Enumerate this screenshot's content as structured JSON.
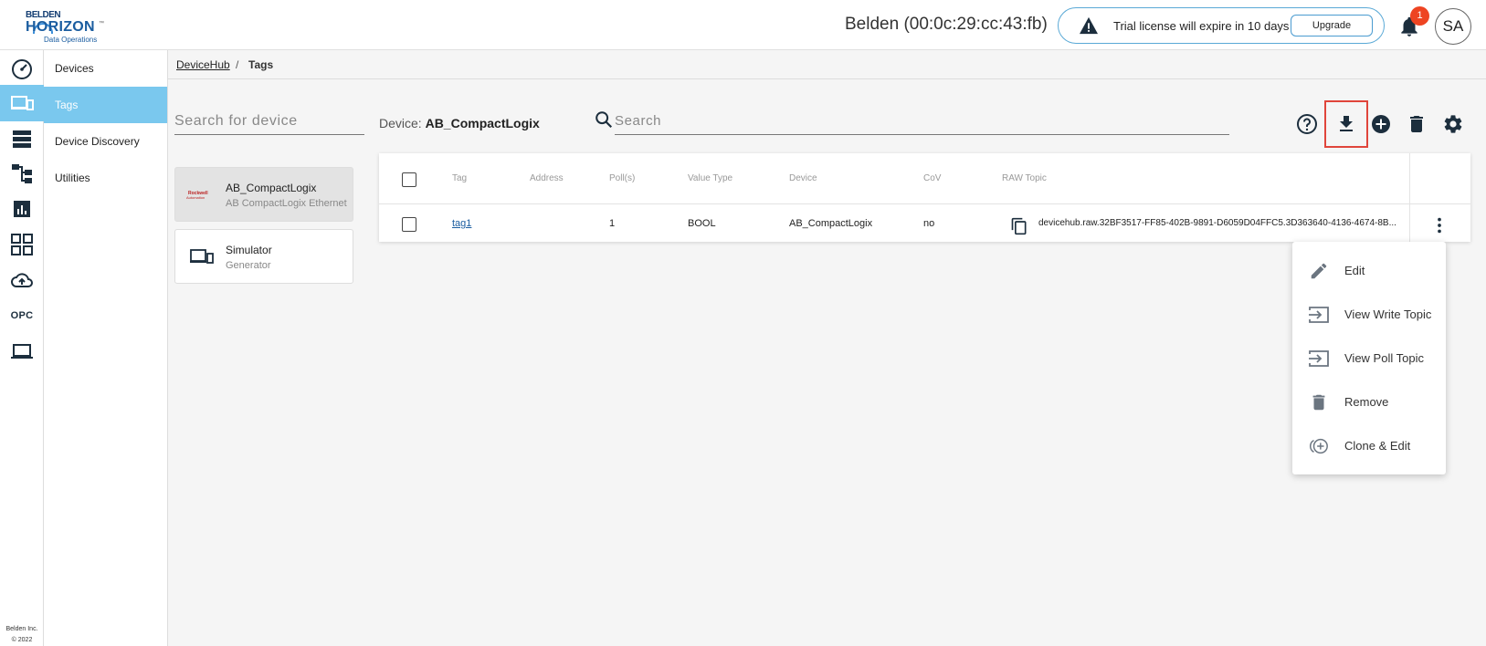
{
  "header": {
    "logo_brand": "BELDEN",
    "logo_product": "HORIZON",
    "logo_tm": "™",
    "logo_sub": "Data Operations",
    "device_id": "Belden (00:0c:29:cc:43:fb)",
    "trial_text": "Trial license will expire in 10 days",
    "upgrade_label": "Upgrade",
    "notification_count": "1",
    "avatar_initials": "SA"
  },
  "rail": {
    "icons": [
      "dashboard-icon",
      "devices-icon",
      "storage-icon",
      "hierarchy-icon",
      "analytics-icon",
      "apps-grid-icon",
      "cloud-upload-icon",
      "opc-label",
      "laptop-icon"
    ],
    "opc_label": "OPC",
    "footer_line1": "Belden Inc.",
    "footer_line2": "© 2022"
  },
  "nav": {
    "items": [
      {
        "label": "Devices"
      },
      {
        "label": "Tags"
      },
      {
        "label": "Device Discovery"
      },
      {
        "label": "Utilities"
      }
    ],
    "active_index": 1
  },
  "breadcrumb": {
    "parent": "DeviceHub",
    "separator": "/",
    "current": "Tags"
  },
  "device_panel": {
    "search_placeholder": "Search for device",
    "devices": [
      {
        "name": "AB_CompactLogix",
        "subtitle": "AB CompactLogix Ethernet",
        "logo_line1": "Rockwell",
        "logo_line2": "Automation",
        "selected": true
      },
      {
        "name": "Simulator",
        "subtitle": "Generator",
        "selected": false
      }
    ]
  },
  "main": {
    "device_label": "Device:",
    "device_name": "AB_CompactLogix",
    "search_placeholder": "Search",
    "toolbar_icons": [
      "help-icon",
      "download-icon",
      "add-icon",
      "delete-icon",
      "settings-icon"
    ]
  },
  "table": {
    "columns": [
      "Tag",
      "Address",
      "Poll(s)",
      "Value Type",
      "Device",
      "CoV",
      "RAW Topic"
    ],
    "rows": [
      {
        "tag": "tag1",
        "address": "",
        "poll": "1",
        "value_type": "BOOL",
        "device": "AB_CompactLogix",
        "cov": "no",
        "raw_topic": "devicehub.raw.32BF3517-FF85-402B-9891-D6059D04FFC5.3D363640-4136-4674-8B..."
      }
    ]
  },
  "context_menu": {
    "items": [
      {
        "label": "Edit",
        "icon": "pencil-icon"
      },
      {
        "label": "View Write Topic",
        "icon": "input-arrow-icon"
      },
      {
        "label": "View Poll Topic",
        "icon": "input-arrow-icon"
      },
      {
        "label": "Remove",
        "icon": "trash-icon"
      },
      {
        "label": "Clone & Edit",
        "icon": "clone-add-icon"
      }
    ]
  },
  "colors": {
    "accent": "#7ac8ee",
    "badge": "#ee4422",
    "highlight": "#e0453b",
    "icon_dark": "#1c2e3d"
  }
}
